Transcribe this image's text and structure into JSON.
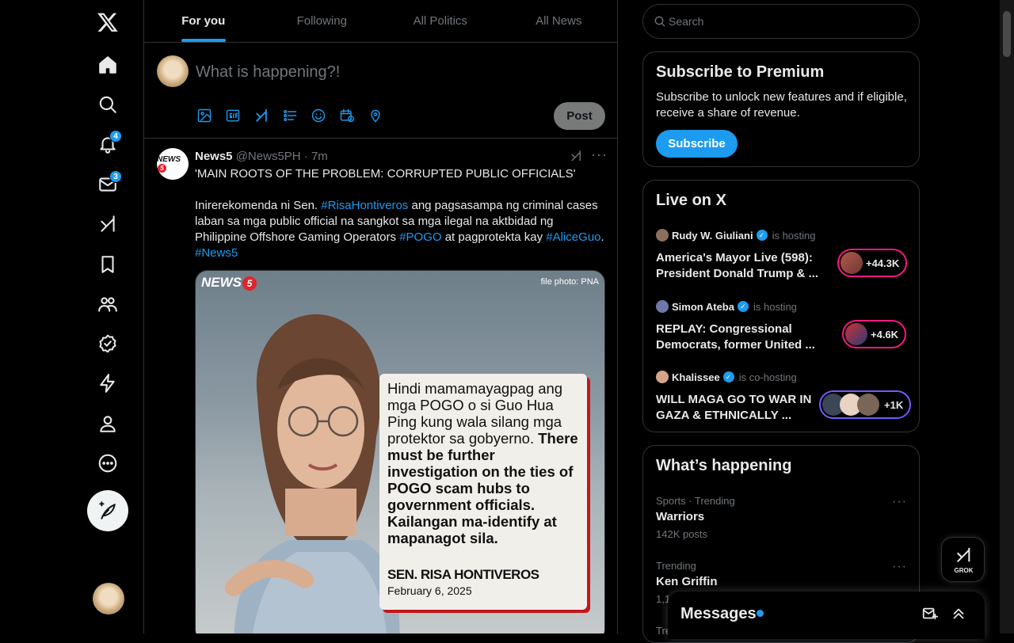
{
  "nav": {
    "notifications_badge": "4",
    "messages_badge": "3"
  },
  "tabs": [
    "For you",
    "Following",
    "All Politics",
    "All News"
  ],
  "composer": {
    "placeholder": "What is happening?!",
    "post_label": "Post"
  },
  "tweet": {
    "name": "News5",
    "handle": "@News5PH",
    "time": "7m",
    "line1": "'MAIN ROOTS OF THE PROBLEM: CORRUPTED PUBLIC OFFICIALS'",
    "p_a": "Inirerekomenda ni Sen. ",
    "tag1": "#RisaHontiveros",
    "p_b": " ang pagsasampa ng criminal cases laban sa mga public official na sangkot sa mga ilegal na aktbidad ng Philippine Offshore Gaming Operators ",
    "tag2": "#POGO",
    "p_c": " at pagprotekta kay ",
    "tag3": "#AliceGuo",
    "p_d": ".",
    "tag4": "#News5",
    "media": {
      "logo": "NEWS",
      "logo_num": "5",
      "credit": "file photo: PNA",
      "quote_plain": "Hindi mamamayagpag ang mga POGO o si Guo Hua Ping kung wala silang mga protektor sa gobyerno. ",
      "quote_bold": "There must be further investigation on the ties of POGO scam hubs to government officials. Kailangan ma-identify at mapanagot sila.",
      "author": "SEN. RISA HONTIVEROS",
      "date": "February 6, 2025"
    }
  },
  "search": {
    "placeholder": "Search"
  },
  "premium": {
    "title": "Subscribe to Premium",
    "desc": "Subscribe to unlock new features and if eligible, receive a share of revenue.",
    "button": "Subscribe"
  },
  "live": {
    "title": "Live on X",
    "items": [
      {
        "host": "Rudy W. Giuliani",
        "status": "is hosting",
        "title": "America's Mayor Live (598): President Donald Trump & ...",
        "count": "+44.3K"
      },
      {
        "host": "Simon Ateba",
        "status": "is hosting",
        "title": "REPLAY: Congressional Democrats, former United ...",
        "count": "+4.6K"
      },
      {
        "host": "Khalissee",
        "status": "is co-hosting",
        "title": "WILL MAGA GO TO WAR IN GAZA & ETHNICALLY ...",
        "count": "+1K"
      }
    ]
  },
  "happening": {
    "title": "What’s happening",
    "trends": [
      {
        "category": "Sports · Trending",
        "name": "Warriors",
        "count": "142K posts"
      },
      {
        "category": "Trending",
        "name": "Ken Griffin",
        "count": "1,1"
      },
      {
        "category": "Tre",
        "name": "",
        "count": ""
      }
    ]
  },
  "grok": {
    "label": "GROK"
  },
  "messages": {
    "title": "Messages"
  },
  "colors": {
    "accent": "#1d9bf0",
    "live_pink": "#f91880",
    "live_purple": "#7856ff",
    "background": "#000000"
  },
  "icons": [
    "x-logo-icon",
    "home-icon",
    "search-icon",
    "bell-icon",
    "mail-icon",
    "grok-icon",
    "bookmark-icon",
    "communities-icon",
    "verified-icon",
    "lightning-icon",
    "profile-icon",
    "more-circle-icon",
    "feather-post-icon"
  ]
}
